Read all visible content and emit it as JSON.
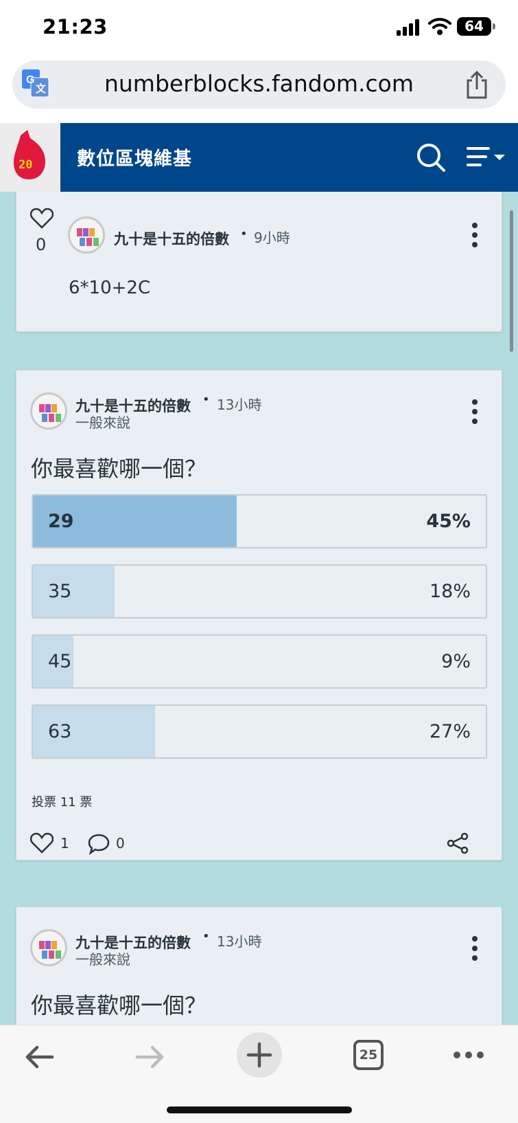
{
  "status_bar": {
    "time": "21:23",
    "battery": "64"
  },
  "browser": {
    "url": "numberblocks.fandom.com",
    "tabs_count": "25"
  },
  "site": {
    "title": "數位區塊維基",
    "logo_text": "20"
  },
  "reply": {
    "likes": "0",
    "author": "九十是十五的倍數",
    "time": "9小時",
    "body": "6*10+2C"
  },
  "poll_post": {
    "author": "九十是十五的倍數",
    "time": "13小時",
    "category": "一般來說",
    "title": "你最喜歡哪一個？",
    "options": [
      {
        "label": "29",
        "percent": "45%",
        "fill": 45
      },
      {
        "label": "35",
        "percent": "18%",
        "fill": 18
      },
      {
        "label": "45",
        "percent": "9%",
        "fill": 9
      },
      {
        "label": "63",
        "percent": "27%",
        "fill": 27
      }
    ],
    "votes": "投票 11 票",
    "likes": "1",
    "comments": "0"
  },
  "next_post": {
    "author": "九十是十五的倍數",
    "time": "13小時",
    "category": "一般來說",
    "title": "你最喜歡哪一個？"
  },
  "colors": {
    "header_bg": "#00468a",
    "content_bg": "#b3dcde",
    "poll_top_fill": "#8dbbdc",
    "poll_fill": "#c6dcea"
  }
}
